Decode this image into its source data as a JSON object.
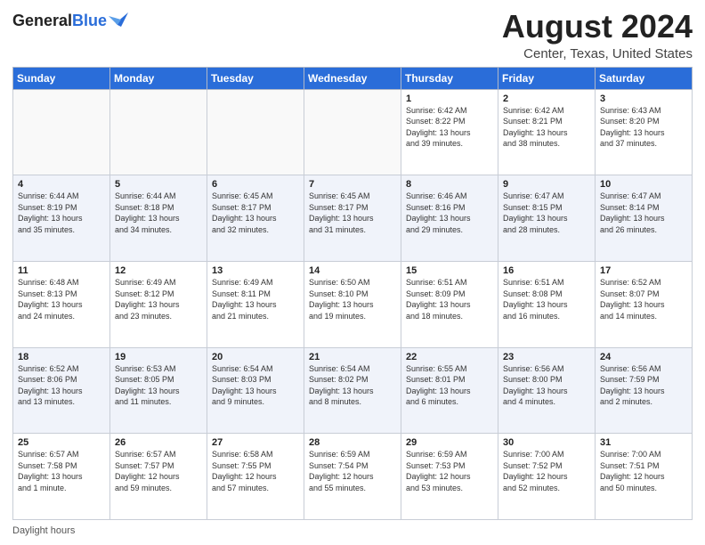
{
  "header": {
    "logo_general": "General",
    "logo_blue": "Blue",
    "main_title": "August 2024",
    "subtitle": "Center, Texas, United States"
  },
  "footer": {
    "note": "Daylight hours"
  },
  "days_of_week": [
    "Sunday",
    "Monday",
    "Tuesday",
    "Wednesday",
    "Thursday",
    "Friday",
    "Saturday"
  ],
  "weeks": [
    [
      {
        "num": "",
        "info": ""
      },
      {
        "num": "",
        "info": ""
      },
      {
        "num": "",
        "info": ""
      },
      {
        "num": "",
        "info": ""
      },
      {
        "num": "1",
        "info": "Sunrise: 6:42 AM\nSunset: 8:22 PM\nDaylight: 13 hours\nand 39 minutes."
      },
      {
        "num": "2",
        "info": "Sunrise: 6:42 AM\nSunset: 8:21 PM\nDaylight: 13 hours\nand 38 minutes."
      },
      {
        "num": "3",
        "info": "Sunrise: 6:43 AM\nSunset: 8:20 PM\nDaylight: 13 hours\nand 37 minutes."
      }
    ],
    [
      {
        "num": "4",
        "info": "Sunrise: 6:44 AM\nSunset: 8:19 PM\nDaylight: 13 hours\nand 35 minutes."
      },
      {
        "num": "5",
        "info": "Sunrise: 6:44 AM\nSunset: 8:18 PM\nDaylight: 13 hours\nand 34 minutes."
      },
      {
        "num": "6",
        "info": "Sunrise: 6:45 AM\nSunset: 8:17 PM\nDaylight: 13 hours\nand 32 minutes."
      },
      {
        "num": "7",
        "info": "Sunrise: 6:45 AM\nSunset: 8:17 PM\nDaylight: 13 hours\nand 31 minutes."
      },
      {
        "num": "8",
        "info": "Sunrise: 6:46 AM\nSunset: 8:16 PM\nDaylight: 13 hours\nand 29 minutes."
      },
      {
        "num": "9",
        "info": "Sunrise: 6:47 AM\nSunset: 8:15 PM\nDaylight: 13 hours\nand 28 minutes."
      },
      {
        "num": "10",
        "info": "Sunrise: 6:47 AM\nSunset: 8:14 PM\nDaylight: 13 hours\nand 26 minutes."
      }
    ],
    [
      {
        "num": "11",
        "info": "Sunrise: 6:48 AM\nSunset: 8:13 PM\nDaylight: 13 hours\nand 24 minutes."
      },
      {
        "num": "12",
        "info": "Sunrise: 6:49 AM\nSunset: 8:12 PM\nDaylight: 13 hours\nand 23 minutes."
      },
      {
        "num": "13",
        "info": "Sunrise: 6:49 AM\nSunset: 8:11 PM\nDaylight: 13 hours\nand 21 minutes."
      },
      {
        "num": "14",
        "info": "Sunrise: 6:50 AM\nSunset: 8:10 PM\nDaylight: 13 hours\nand 19 minutes."
      },
      {
        "num": "15",
        "info": "Sunrise: 6:51 AM\nSunset: 8:09 PM\nDaylight: 13 hours\nand 18 minutes."
      },
      {
        "num": "16",
        "info": "Sunrise: 6:51 AM\nSunset: 8:08 PM\nDaylight: 13 hours\nand 16 minutes."
      },
      {
        "num": "17",
        "info": "Sunrise: 6:52 AM\nSunset: 8:07 PM\nDaylight: 13 hours\nand 14 minutes."
      }
    ],
    [
      {
        "num": "18",
        "info": "Sunrise: 6:52 AM\nSunset: 8:06 PM\nDaylight: 13 hours\nand 13 minutes."
      },
      {
        "num": "19",
        "info": "Sunrise: 6:53 AM\nSunset: 8:05 PM\nDaylight: 13 hours\nand 11 minutes."
      },
      {
        "num": "20",
        "info": "Sunrise: 6:54 AM\nSunset: 8:03 PM\nDaylight: 13 hours\nand 9 minutes."
      },
      {
        "num": "21",
        "info": "Sunrise: 6:54 AM\nSunset: 8:02 PM\nDaylight: 13 hours\nand 8 minutes."
      },
      {
        "num": "22",
        "info": "Sunrise: 6:55 AM\nSunset: 8:01 PM\nDaylight: 13 hours\nand 6 minutes."
      },
      {
        "num": "23",
        "info": "Sunrise: 6:56 AM\nSunset: 8:00 PM\nDaylight: 13 hours\nand 4 minutes."
      },
      {
        "num": "24",
        "info": "Sunrise: 6:56 AM\nSunset: 7:59 PM\nDaylight: 13 hours\nand 2 minutes."
      }
    ],
    [
      {
        "num": "25",
        "info": "Sunrise: 6:57 AM\nSunset: 7:58 PM\nDaylight: 13 hours\nand 1 minute."
      },
      {
        "num": "26",
        "info": "Sunrise: 6:57 AM\nSunset: 7:57 PM\nDaylight: 12 hours\nand 59 minutes."
      },
      {
        "num": "27",
        "info": "Sunrise: 6:58 AM\nSunset: 7:55 PM\nDaylight: 12 hours\nand 57 minutes."
      },
      {
        "num": "28",
        "info": "Sunrise: 6:59 AM\nSunset: 7:54 PM\nDaylight: 12 hours\nand 55 minutes."
      },
      {
        "num": "29",
        "info": "Sunrise: 6:59 AM\nSunset: 7:53 PM\nDaylight: 12 hours\nand 53 minutes."
      },
      {
        "num": "30",
        "info": "Sunrise: 7:00 AM\nSunset: 7:52 PM\nDaylight: 12 hours\nand 52 minutes."
      },
      {
        "num": "31",
        "info": "Sunrise: 7:00 AM\nSunset: 7:51 PM\nDaylight: 12 hours\nand 50 minutes."
      }
    ]
  ]
}
